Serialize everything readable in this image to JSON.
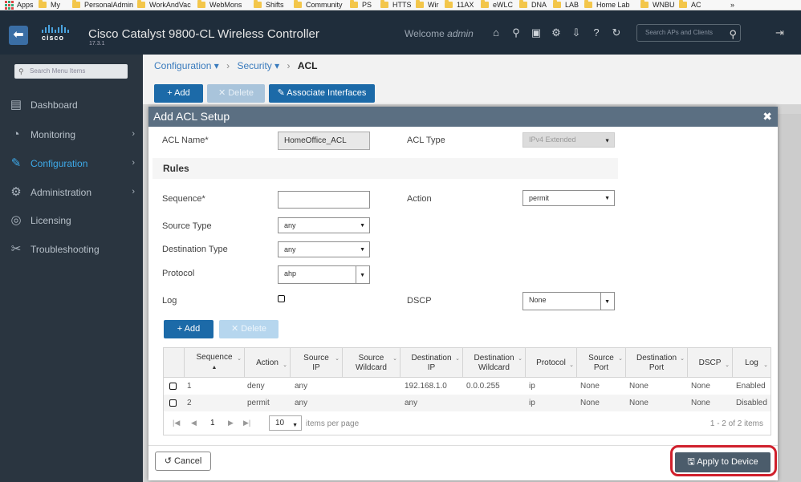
{
  "bookmarks": {
    "apps_label": "Apps",
    "items": [
      "My",
      "PersonalAdmin",
      "WorkAndVac",
      "WebMons",
      "Shifts",
      "Community",
      "PS",
      "HTTS",
      "Wir",
      "11AX",
      "eWLC",
      "DNA",
      "LAB",
      "Home Lab",
      "WNBU",
      "AC"
    ],
    "overflow": "»"
  },
  "header": {
    "title": "Cisco Catalyst 9800-CL Wireless Controller",
    "version": "17.3.1",
    "logo_text": "cisco",
    "welcome_prefix": "Welcome",
    "welcome_user": "admin",
    "search_placeholder": "Search APs and Clients",
    "icons": [
      "home-icon",
      "wireless-icon",
      "save-icon",
      "gear-icon",
      "download-icon",
      "help-icon",
      "refresh-icon"
    ]
  },
  "sidebar": {
    "search_placeholder": "Search Menu Items",
    "items": [
      {
        "label": "Dashboard",
        "icon": "dashboard-icon"
      },
      {
        "label": "Monitoring",
        "icon": "monitoring-icon"
      },
      {
        "label": "Configuration",
        "icon": "wrench-icon"
      },
      {
        "label": "Administration",
        "icon": "gear-icon"
      },
      {
        "label": "Licensing",
        "icon": "license-icon"
      },
      {
        "label": "Troubleshooting",
        "icon": "tools-icon"
      }
    ],
    "active": "Configuration"
  },
  "breadcrumb": {
    "level1": "Configuration",
    "level2": "Security",
    "current": "ACL"
  },
  "toolbar": {
    "add_label": "Add",
    "delete_label": "Delete",
    "associate_label": "Associate Interfaces"
  },
  "modal": {
    "title": "Add ACL Setup",
    "acl_name_label": "ACL Name*",
    "acl_name_value": "HomeOffice_ACL",
    "acl_type_label": "ACL Type",
    "acl_type_value": "IPv4 Extended",
    "rules_heading": "Rules",
    "sequence_label": "Sequence*",
    "sequence_value": "",
    "action_label": "Action",
    "action_value": "permit",
    "source_type_label": "Source Type",
    "source_type_value": "any",
    "dest_type_label": "Destination Type",
    "dest_type_value": "any",
    "protocol_label": "Protocol",
    "protocol_value": "ahp",
    "log_label": "Log",
    "dscp_label": "DSCP",
    "dscp_value": "None",
    "add_label": "Add",
    "delete_label": "Delete",
    "cancel_label": "Cancel",
    "apply_label": "Apply to Device"
  },
  "grid": {
    "columns": [
      {
        "line1": "Sequence",
        "line2": "▲"
      },
      {
        "line1": "Action",
        "line2": ""
      },
      {
        "line1": "Source",
        "line2": "IP"
      },
      {
        "line1": "Source",
        "line2": "Wildcard"
      },
      {
        "line1": "Destination",
        "line2": "IP"
      },
      {
        "line1": "Destination",
        "line2": "Wildcard"
      },
      {
        "line1": "Protocol",
        "line2": ""
      },
      {
        "line1": "Source",
        "line2": "Port"
      },
      {
        "line1": "Destination",
        "line2": "Port"
      },
      {
        "line1": "DSCP",
        "line2": ""
      },
      {
        "line1": "Log",
        "line2": ""
      }
    ],
    "rows": [
      {
        "sequence": "1",
        "action": "deny",
        "source_ip": "any",
        "source_wildcard": "",
        "dest_ip": "192.168.1.0",
        "dest_wildcard": "0.0.0.255",
        "protocol": "ip",
        "source_port": "None",
        "dest_port": "None",
        "dscp": "None",
        "log": "Enabled"
      },
      {
        "sequence": "2",
        "action": "permit",
        "source_ip": "any",
        "source_wildcard": "",
        "dest_ip": "any",
        "dest_wildcard": "",
        "protocol": "ip",
        "source_port": "None",
        "dest_port": "None",
        "dscp": "None",
        "log": "Disabled"
      }
    ],
    "pager": {
      "current_page": "1",
      "per_page": "10",
      "per_page_label": "items per page",
      "summary": "1 - 2 of 2 items"
    }
  },
  "colors": {
    "header_bg": "#1f2d3b",
    "sidebar_bg": "#2a3540",
    "accent": "#1c6aa8",
    "active_nav": "#3ea9e8",
    "modal_head": "#5b6f82",
    "highlight": "#d0202c"
  }
}
